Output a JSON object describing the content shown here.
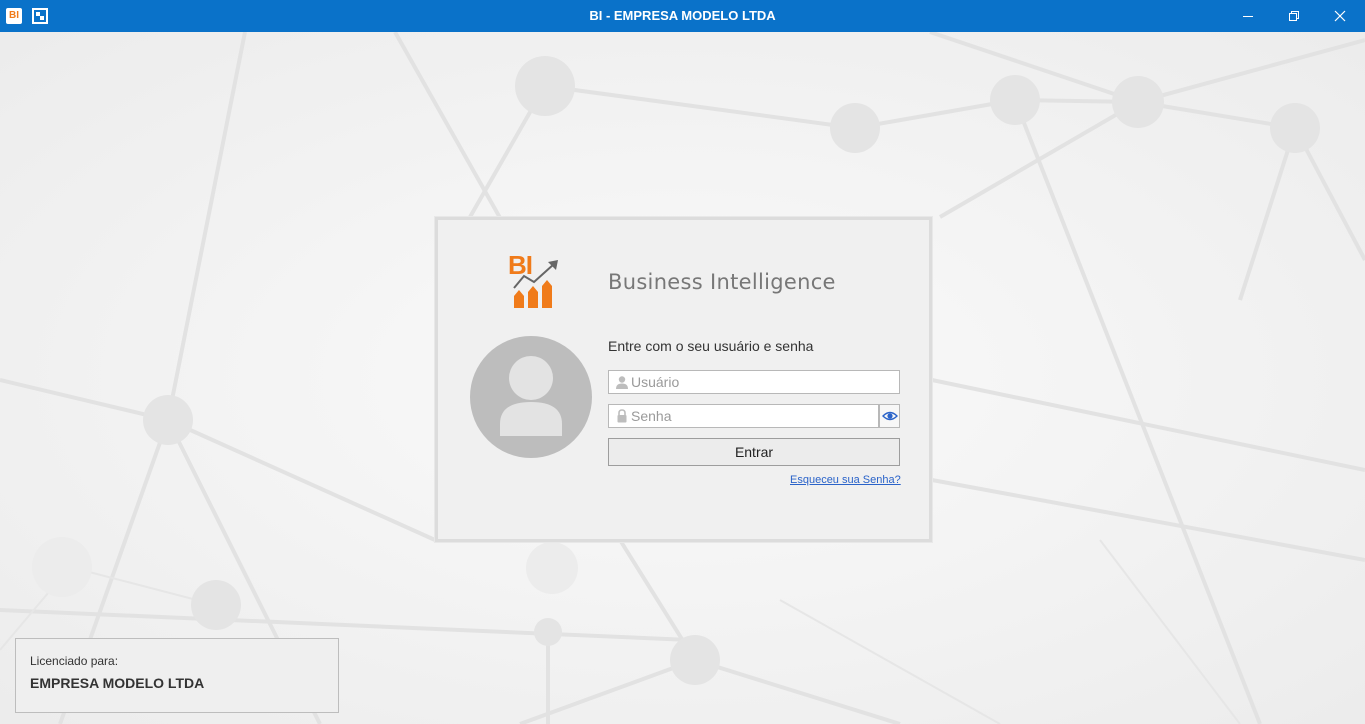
{
  "window": {
    "title": "BI - EMPRESA MODELO LTDA",
    "app_icon_text": "BI",
    "app_icon": "bi-app-icon",
    "layout_icon": "window-layout-icon",
    "minimize_icon": "minimize-icon",
    "restore_icon": "restore-icon",
    "close_icon": "close-icon"
  },
  "login": {
    "logo_text": "BI",
    "brand": "Business Intelligence",
    "prompt": "Entre com o seu usuário e senha",
    "username": {
      "placeholder": "Usuário",
      "value": "",
      "icon": "user-icon"
    },
    "password": {
      "placeholder": "Senha",
      "value": "",
      "icon": "lock-icon"
    },
    "show_password_icon": "eye-icon",
    "submit_label": "Entrar",
    "forgot_label": "Esqueceu sua Senha?"
  },
  "license": {
    "label": "Licenciado para:",
    "company": "EMPRESA MODELO LTDA"
  },
  "colors": {
    "titlebar": "#0a72c9",
    "brand_orange": "#f07b1a",
    "link": "#2a63c9",
    "background": "#f2f2f2"
  }
}
